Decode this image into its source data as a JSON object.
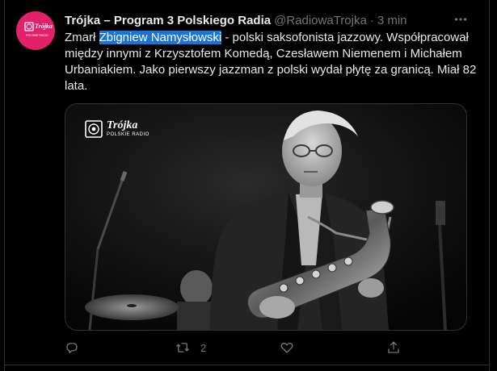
{
  "tweet": {
    "author_name": "Trójka – Program 3 Polskiego Radia",
    "handle": "@RadiowaTrojka",
    "separator": "·",
    "time": "3 min",
    "text_before": "Zmarł ",
    "text_highlight": "Zbigniew Namysłowski",
    "text_after": " - polski saksofonista jazzowy. Współpracował między innymi z Krzysztofem Komedą, Czesławem Niemenem i Michałem Urbaniakiem. Jako pierwszy jazzman z polski wydał płytę za granicą. Miał 82 lata.",
    "avatar_logo_text": "Trójka",
    "avatar_logo_subtext": "POLSKIE RADIO",
    "media_watermark_title": "Trójka",
    "media_watermark_subtitle": "POLSKIE RADIO",
    "retweet_count": "2"
  },
  "icons": {
    "more": "more-dots-icon",
    "reply": "reply-icon",
    "retweet": "retweet-icon",
    "like": "like-icon",
    "share": "share-icon"
  },
  "colors": {
    "background": "#000000",
    "text_primary": "#e7e9ea",
    "text_secondary": "#71767b",
    "brand": "#e3216a",
    "selection_highlight": "#1a73d9",
    "border": "#2f3336"
  }
}
